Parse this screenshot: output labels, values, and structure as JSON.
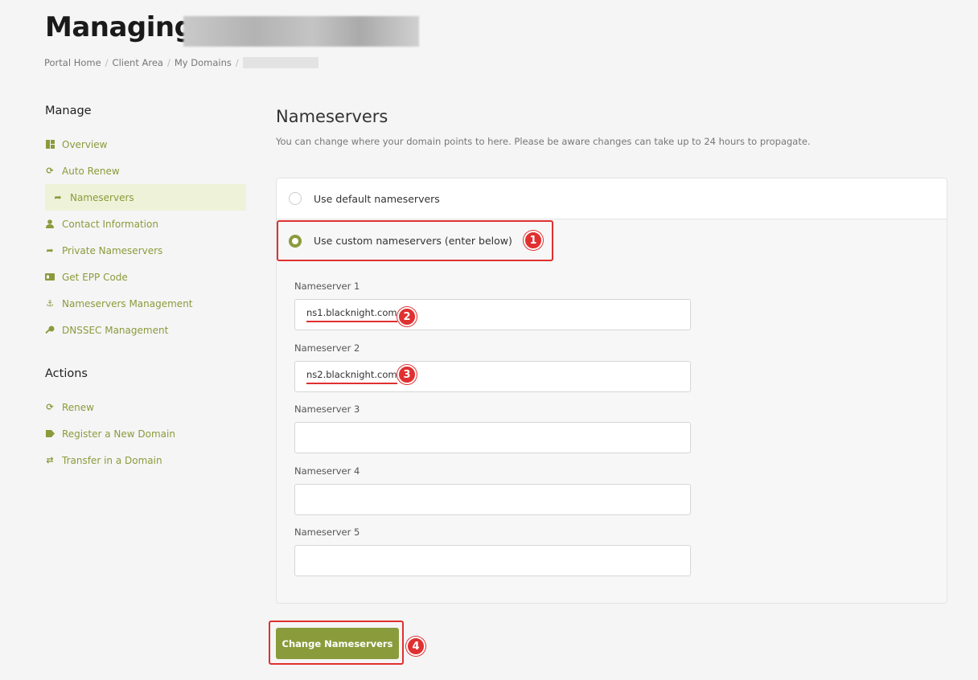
{
  "header": {
    "title": "Managing"
  },
  "breadcrumb": [
    "Portal Home",
    "Client Area",
    "My Domains"
  ],
  "sidebar": {
    "manage_heading": "Manage",
    "manage_items": [
      {
        "label": "Overview",
        "icon": "dashboard-icon"
      },
      {
        "label": "Auto Renew",
        "icon": "refresh-icon"
      },
      {
        "label": "Nameservers",
        "icon": "share-arrow-icon",
        "active": true
      },
      {
        "label": "Contact Information",
        "icon": "user-icon"
      },
      {
        "label": "Private Nameservers",
        "icon": "share-arrow-icon"
      },
      {
        "label": "Get EPP Code",
        "icon": "id-card-icon"
      },
      {
        "label": "Nameservers Management",
        "icon": "anchor-icon"
      },
      {
        "label": "DNSSEC Management",
        "icon": "key-icon"
      }
    ],
    "actions_heading": "Actions",
    "action_items": [
      {
        "label": "Renew",
        "icon": "refresh-icon"
      },
      {
        "label": "Register a New Domain",
        "icon": "tag-icon"
      },
      {
        "label": "Transfer in a Domain",
        "icon": "exchange-icon"
      }
    ]
  },
  "main": {
    "title": "Nameservers",
    "description": "You can change where your domain points to here. Please be aware changes can take up to 24 hours to propagate.",
    "option_default": "Use default nameservers",
    "option_custom": "Use custom nameservers (enter below)",
    "selected_option": "custom",
    "fields": [
      {
        "label": "Nameserver 1",
        "value": "ns1.blacknight.com"
      },
      {
        "label": "Nameserver 2",
        "value": "ns2.blacknight.com"
      },
      {
        "label": "Nameserver 3",
        "value": ""
      },
      {
        "label": "Nameserver 4",
        "value": ""
      },
      {
        "label": "Nameserver 5",
        "value": ""
      }
    ],
    "submit_label": "Change Nameservers"
  },
  "annotations": [
    "1",
    "2",
    "3",
    "4"
  ],
  "colors": {
    "accent": "#8a9b3c",
    "annotation": "#e03030",
    "active_bg": "#eef2d8"
  }
}
